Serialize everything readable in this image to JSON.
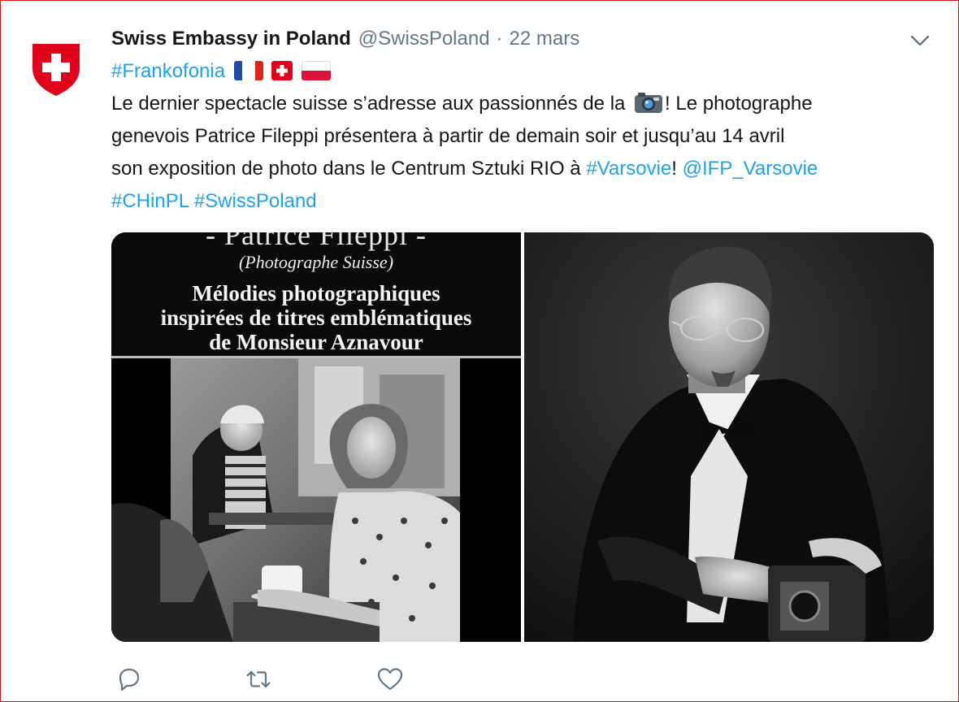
{
  "tweet": {
    "author_name": "Swiss Embassy in Poland",
    "handle": "@SwissPoland",
    "separator": "·",
    "date": "22 mars",
    "hashtag_line": "#Frankofonia",
    "flags": [
      "france-flag-icon",
      "swiss-flag-icon",
      "poland-flag-icon"
    ],
    "line1_a": "Le dernier spectacle suisse s’adresse aux passionnés de la",
    "line1_b": "! Le photographe",
    "line2": "genevois Patrice Fileppi présentera à partir de demain soir et jusqu’au 14 avril",
    "line3_a": "son exposition de photo dans le Centrum Sztuki RIO à ",
    "line3_link1": "#Varsovie",
    "line3_b": "! ",
    "line3_link2": "@IFP_Varsovie",
    "line4_link1": "#CHinPL",
    "line4_link2": "#SwissPoland"
  },
  "media": {
    "poster": {
      "name": "- Patrice Fileppi -",
      "subtitle": "(Photographe Suisse)",
      "title_line1": "Mélodies photographiques",
      "title_line2": "inspirées de titres emblématiques",
      "title_line3": "de Monsieur Aznavour"
    }
  },
  "actions": [
    "reply-icon",
    "retweet-icon",
    "like-icon"
  ],
  "colors": {
    "link": "#1da1f2",
    "muted": "#657786",
    "swiss_red": "#e2001a"
  }
}
